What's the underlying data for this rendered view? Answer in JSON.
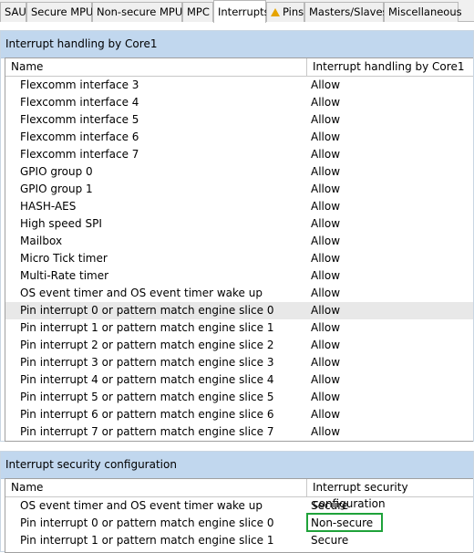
{
  "tabs": [
    "SAU",
    "Secure MPU",
    "Non-secure MPU",
    "MPC",
    "Interrupts",
    "Pins",
    "Masters/Slaves",
    "Miscellaneous"
  ],
  "active_tab": "Interrupts",
  "handling": {
    "title": "Interrupt handling by Core1",
    "col_name": "Name",
    "col_value": "Interrupt handling by Core1",
    "rows": [
      {
        "name": "Flexcomm interface 3",
        "value": "Allow"
      },
      {
        "name": "Flexcomm interface 4",
        "value": "Allow"
      },
      {
        "name": "Flexcomm interface 5",
        "value": "Allow"
      },
      {
        "name": "Flexcomm interface 6",
        "value": "Allow"
      },
      {
        "name": "Flexcomm interface 7",
        "value": "Allow"
      },
      {
        "name": "GPIO group 0",
        "value": "Allow"
      },
      {
        "name": "GPIO group 1",
        "value": "Allow"
      },
      {
        "name": "HASH-AES",
        "value": "Allow"
      },
      {
        "name": "High speed SPI",
        "value": "Allow"
      },
      {
        "name": "Mailbox",
        "value": "Allow"
      },
      {
        "name": "Micro Tick timer",
        "value": "Allow"
      },
      {
        "name": "Multi-Rate timer",
        "value": "Allow"
      },
      {
        "name": "OS event timer and OS event timer wake up",
        "value": "Allow"
      },
      {
        "name": "Pin interrupt 0 or pattern match engine slice 0",
        "value": "Allow"
      },
      {
        "name": "Pin interrupt 1 or pattern match engine slice 1",
        "value": "Allow"
      },
      {
        "name": "Pin interrupt 2 or pattern match engine slice 2",
        "value": "Allow"
      },
      {
        "name": "Pin interrupt 3 or pattern match engine slice 3",
        "value": "Allow"
      },
      {
        "name": "Pin interrupt 4 or pattern match engine slice 4",
        "value": "Allow"
      },
      {
        "name": "Pin interrupt 5 or pattern match engine slice 5",
        "value": "Allow"
      },
      {
        "name": "Pin interrupt 6 or pattern match engine slice 6",
        "value": "Allow"
      },
      {
        "name": "Pin interrupt 7 or pattern match engine slice 7",
        "value": "Allow"
      }
    ]
  },
  "security": {
    "title": "Interrupt security configuration",
    "col_name": "Name",
    "col_value": "Interrupt security configuration",
    "rows": [
      {
        "name": "OS event timer and OS event timer wake up",
        "value": "Secure"
      },
      {
        "name": "Pin interrupt 0 or pattern match engine slice 0",
        "value": "Non-secure"
      },
      {
        "name": "Pin interrupt 1 or pattern match engine slice 1",
        "value": "Secure"
      }
    ]
  },
  "colors": {
    "highlight": "#1fa23a",
    "header_bg": "#c1d7ee",
    "selected_row": "#e8e8e8"
  }
}
